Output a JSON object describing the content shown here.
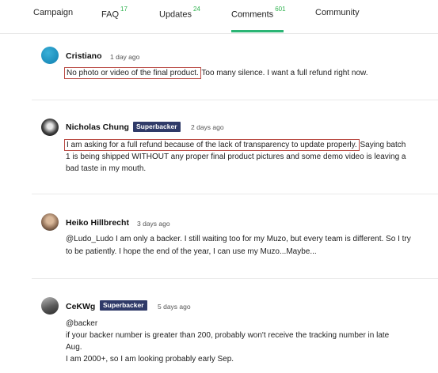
{
  "tabs": [
    {
      "label": "Campaign",
      "count": ""
    },
    {
      "label": "FAQ",
      "count": "17"
    },
    {
      "label": "Updates",
      "count": "24"
    },
    {
      "label": "Comments",
      "count": "601"
    },
    {
      "label": "Community",
      "count": ""
    }
  ],
  "comments": [
    {
      "author": "Cristiano",
      "badge": "",
      "time": "1 day ago",
      "highlight": "No photo or video of the final product.",
      "lines": [
        " Too many silence. I want a full refund right now."
      ]
    },
    {
      "author": "Nicholas Chung",
      "badge": "Superbacker",
      "time": "2 days ago",
      "highlight": "I am asking for a full refund because of the lack of transparency to update properly.",
      "lines": [
        " Saying batch",
        "1 is being shipped WITHOUT any proper final product pictures and some demo video is leaving a",
        "bad taste in my mouth."
      ]
    },
    {
      "author": "Heiko Hillbrecht",
      "badge": "",
      "time": "3 days ago",
      "lines": [
        "@Ludo_Ludo I am only a backer. I still waiting too for my Muzo, but every team is different. So I try",
        "to be patiently. I hope the end of the year, I can use my Muzo...Maybe..."
      ]
    },
    {
      "author": "CeKWg",
      "badge": "Superbacker",
      "time": "5 days ago",
      "lines": [
        "@backer",
        "if your backer number is greater than 200, probably won't receive the tracking number in late",
        "Aug.",
        "I am 2000+, so I am looking probably early Sep."
      ]
    }
  ],
  "colors": {
    "accent": "#2bb575",
    "count": "#2fb34f",
    "badge_bg": "#2f3a68",
    "highlight_border": "#b94a43"
  }
}
